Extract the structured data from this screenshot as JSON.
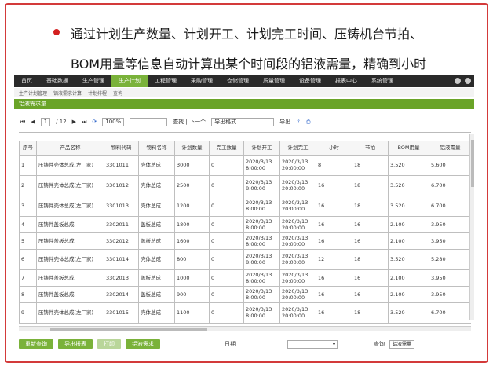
{
  "headline": {
    "line1": "通过计划生产数量、计划开工、计划完工时间、压铸机台节拍、",
    "line2": "BOM用量等信息自动计算出某个时间段的铝液需量，精确到小时"
  },
  "nav": {
    "tabs": [
      "首页",
      "基础数据",
      "生产管理",
      "生产计划",
      "工程管理",
      "采购管理",
      "仓储管理",
      "质量管理",
      "设备管理",
      "报表中心",
      "系统管理"
    ],
    "active_index": 3
  },
  "breadcrumbs": [
    "生产计划管理",
    "铝液需求计算",
    "计划排程",
    "查询"
  ],
  "section_title": "铝液需求量",
  "toolbar": {
    "page_current": "1",
    "page_total": "/ 12",
    "zoom": "100%",
    "find_label": "查找 | 下一个",
    "format": "导出格式",
    "export": "导出"
  },
  "table": {
    "headers": [
      "序号",
      "产品名称",
      "物料代码",
      "物料名称",
      "计划数量",
      "完工数量",
      "计划开工",
      "计划完工",
      "小时",
      "节拍",
      "BOM用量",
      "铝液需量"
    ],
    "rows": [
      [
        "1",
        "压铸件壳体总成(左厂家)",
        "3301011",
        "壳体总成",
        "3000",
        "0",
        "2020/3/13 8:00:00",
        "2020/3/13 20:00:00",
        "8",
        "18",
        "3.520",
        "5.600"
      ],
      [
        "2",
        "压铸件壳体总成(左厂家)",
        "3301012",
        "壳体总成",
        "2500",
        "0",
        "2020/3/13 8:00:00",
        "2020/3/13 20:00:00",
        "16",
        "18",
        "3.520",
        "6.700"
      ],
      [
        "3",
        "压铸件壳体总成(左厂家)",
        "3301013",
        "壳体总成",
        "1200",
        "0",
        "2020/3/13 8:00:00",
        "2020/3/13 20:00:00",
        "16",
        "18",
        "3.520",
        "6.700"
      ],
      [
        "4",
        "压铸件盖板总成",
        "3302011",
        "盖板总成",
        "1800",
        "0",
        "2020/3/13 8:00:00",
        "2020/3/13 20:00:00",
        "16",
        "16",
        "2.100",
        "3.950"
      ],
      [
        "5",
        "压铸件盖板总成",
        "3302012",
        "盖板总成",
        "1600",
        "0",
        "2020/3/13 8:00:00",
        "2020/3/13 20:00:00",
        "16",
        "16",
        "2.100",
        "3.950"
      ],
      [
        "6",
        "压铸件壳体总成(左厂家)",
        "3301014",
        "壳体总成",
        "800",
        "0",
        "2020/3/13 8:00:00",
        "2020/3/13 20:00:00",
        "12",
        "18",
        "3.520",
        "5.280"
      ],
      [
        "7",
        "压铸件盖板总成",
        "3302013",
        "盖板总成",
        "1000",
        "0",
        "2020/3/13 8:00:00",
        "2020/3/13 20:00:00",
        "16",
        "16",
        "2.100",
        "3.950"
      ],
      [
        "8",
        "压铸件盖板总成",
        "3302014",
        "盖板总成",
        "900",
        "0",
        "2020/3/13 8:00:00",
        "2020/3/13 20:00:00",
        "16",
        "16",
        "2.100",
        "3.950"
      ],
      [
        "9",
        "压铸件壳体总成(左厂家)",
        "3301015",
        "壳体总成",
        "1100",
        "0",
        "2020/3/13 8:00:00",
        "2020/3/13 20:00:00",
        "16",
        "18",
        "3.520",
        "6.700"
      ]
    ]
  },
  "footer": {
    "buttons": [
      "重新查询",
      "导出报表",
      "打印",
      "铝液需求"
    ],
    "label": "日期",
    "right_label": "查询",
    "right_select": "铝液需量"
  },
  "colors": {
    "accent": "#7ab23a",
    "frame": "#d33a3a",
    "nav": "#2a2a2a"
  }
}
